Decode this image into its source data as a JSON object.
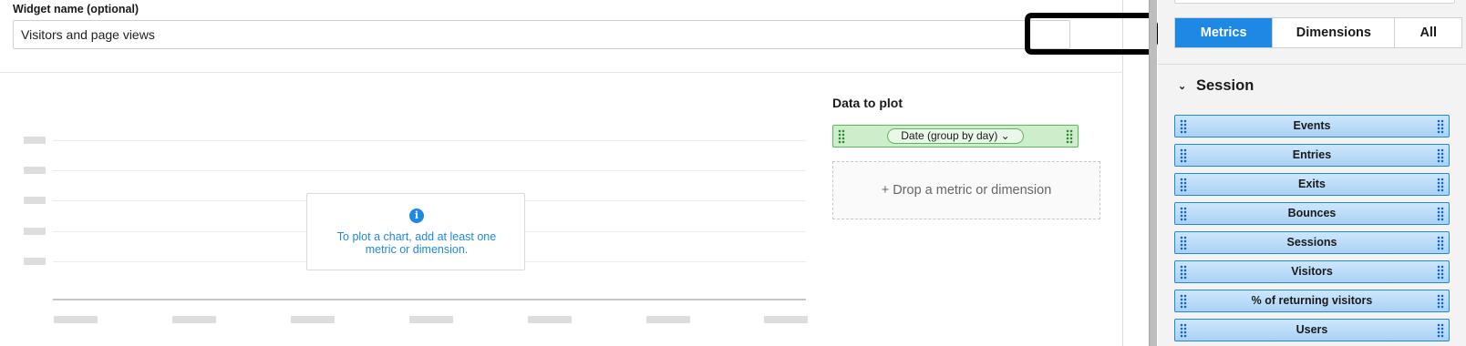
{
  "widget_name": {
    "label": "Widget name (optional)",
    "value": "Visitors and page views"
  },
  "chart_placeholder": {
    "message": "To plot a chart, add at least one metric or dimension.",
    "icon": "info-icon"
  },
  "data_to_plot": {
    "title": "Data to plot",
    "dimension_chip": "Date (group by day) ⌄",
    "drop_hint": "+ Drop a metric or dimension"
  },
  "panel": {
    "tabs": [
      {
        "label": "Metrics",
        "active": true
      },
      {
        "label": "Dimensions",
        "active": false
      },
      {
        "label": "All",
        "active": false
      }
    ],
    "section": {
      "title": "Session",
      "items": [
        "Events",
        "Entries",
        "Exits",
        "Bounces",
        "Sessions",
        "Visitors",
        "% of returning visitors",
        "Users"
      ]
    }
  },
  "colors": {
    "accent": "#1e88e5",
    "dimension_green": "#5cb85c",
    "metric_fill": "#a9d2f6"
  }
}
